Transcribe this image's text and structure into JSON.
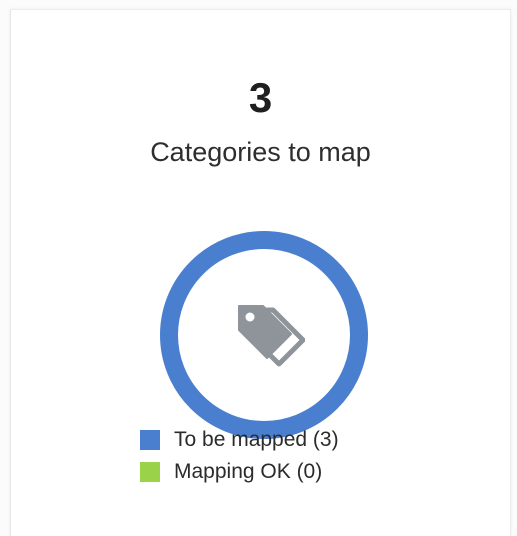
{
  "summary": {
    "count": "3",
    "label": "Categories to map"
  },
  "donut": {
    "icon": "tags-icon",
    "segments": [
      {
        "name": "To be mapped",
        "value": 3,
        "color": "#4a7fd0"
      },
      {
        "name": "Mapping OK",
        "value": 0,
        "color": "#9ad24a"
      }
    ]
  },
  "legend": {
    "items": [
      {
        "label": "To be mapped (3)",
        "color": "#4a7fd0"
      },
      {
        "label": "Mapping OK (0)",
        "color": "#9ad24a"
      }
    ]
  },
  "colors": {
    "icon": "#8e949a"
  }
}
